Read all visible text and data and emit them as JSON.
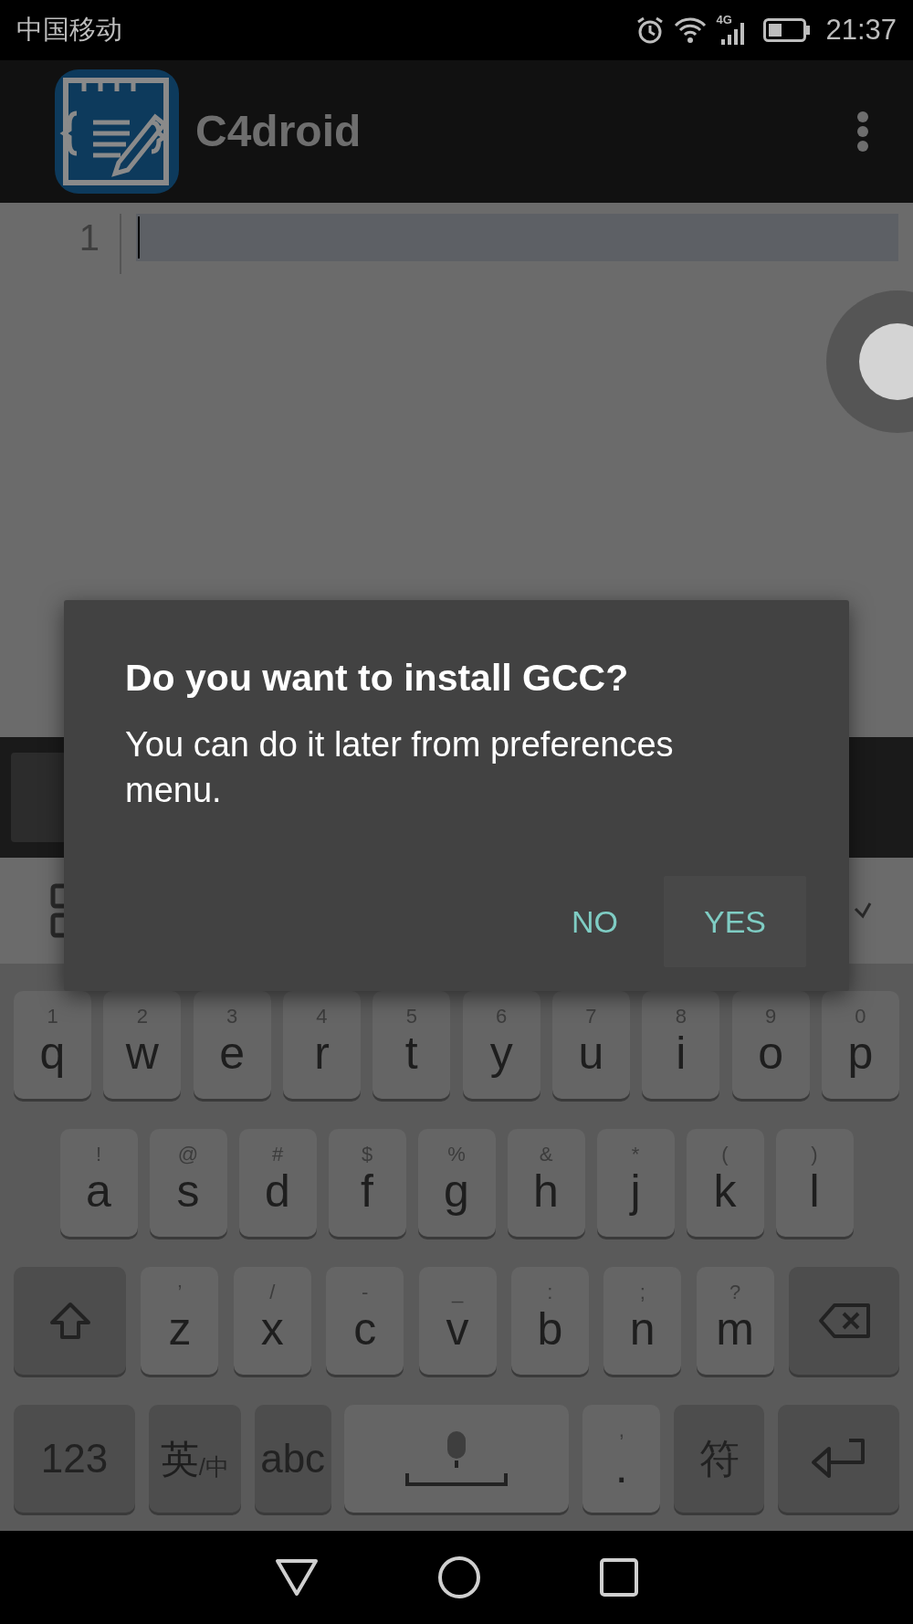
{
  "status_bar": {
    "carrier": "中国移动",
    "network": "4G",
    "time": "21:37"
  },
  "app_bar": {
    "title": "C4droid"
  },
  "editor": {
    "line_numbers": [
      "1"
    ]
  },
  "dialog": {
    "title": "Do you want to install GCC?",
    "message": "You can do it later from preferences menu.",
    "buttons": [
      {
        "label": "NO",
        "highlighted": false
      },
      {
        "label": "YES",
        "highlighted": true
      }
    ]
  },
  "keyboard": {
    "key_lines": [
      {
        "keys": [
          {
            "kind": "letter",
            "hint": "1",
            "label": "q"
          },
          {
            "kind": "letter",
            "hint": "2",
            "label": "w"
          },
          {
            "kind": "letter",
            "hint": "3",
            "label": "e"
          },
          {
            "kind": "letter",
            "hint": "4",
            "label": "r"
          },
          {
            "kind": "letter",
            "hint": "5",
            "label": "t"
          },
          {
            "kind": "letter",
            "hint": "6",
            "label": "y"
          },
          {
            "kind": "letter",
            "hint": "7",
            "label": "u"
          },
          {
            "kind": "letter",
            "hint": "8",
            "label": "i"
          },
          {
            "kind": "letter",
            "hint": "9",
            "label": "o"
          },
          {
            "kind": "letter",
            "hint": "0",
            "label": "p"
          }
        ]
      },
      {
        "keys": [
          {
            "kind": "letter",
            "hint": "!",
            "label": "a"
          },
          {
            "kind": "letter",
            "hint": "@",
            "label": "s"
          },
          {
            "kind": "letter",
            "hint": "#",
            "label": "d"
          },
          {
            "kind": "letter",
            "hint": "$",
            "label": "f"
          },
          {
            "kind": "letter",
            "hint": "%",
            "label": "g"
          },
          {
            "kind": "letter",
            "hint": "&",
            "label": "h"
          },
          {
            "kind": "letter",
            "hint": "*",
            "label": "j"
          },
          {
            "kind": "letter",
            "hint": "(",
            "label": "k"
          },
          {
            "kind": "letter",
            "hint": ")",
            "label": "l"
          }
        ]
      },
      {
        "keys": [
          {
            "kind": "shift"
          },
          {
            "kind": "letter",
            "hint": "’",
            "label": "z"
          },
          {
            "kind": "letter",
            "hint": "/",
            "label": "x"
          },
          {
            "kind": "letter",
            "hint": "-",
            "label": "c"
          },
          {
            "kind": "letter",
            "hint": "_",
            "label": "v"
          },
          {
            "kind": "letter",
            "hint": ":",
            "label": "b"
          },
          {
            "kind": "letter",
            "hint": ";",
            "label": "n"
          },
          {
            "kind": "letter",
            "hint": "?",
            "label": "m"
          },
          {
            "kind": "backspace"
          }
        ]
      },
      {
        "keys": [
          {
            "kind": "func",
            "label": "123"
          },
          {
            "kind": "lang",
            "label": "英",
            "sub": "/中"
          },
          {
            "kind": "func",
            "label": "abc"
          },
          {
            "kind": "space"
          },
          {
            "kind": "letter",
            "hint": ",",
            "label": "."
          },
          {
            "kind": "func",
            "label": "符"
          },
          {
            "kind": "enter"
          }
        ]
      }
    ]
  }
}
